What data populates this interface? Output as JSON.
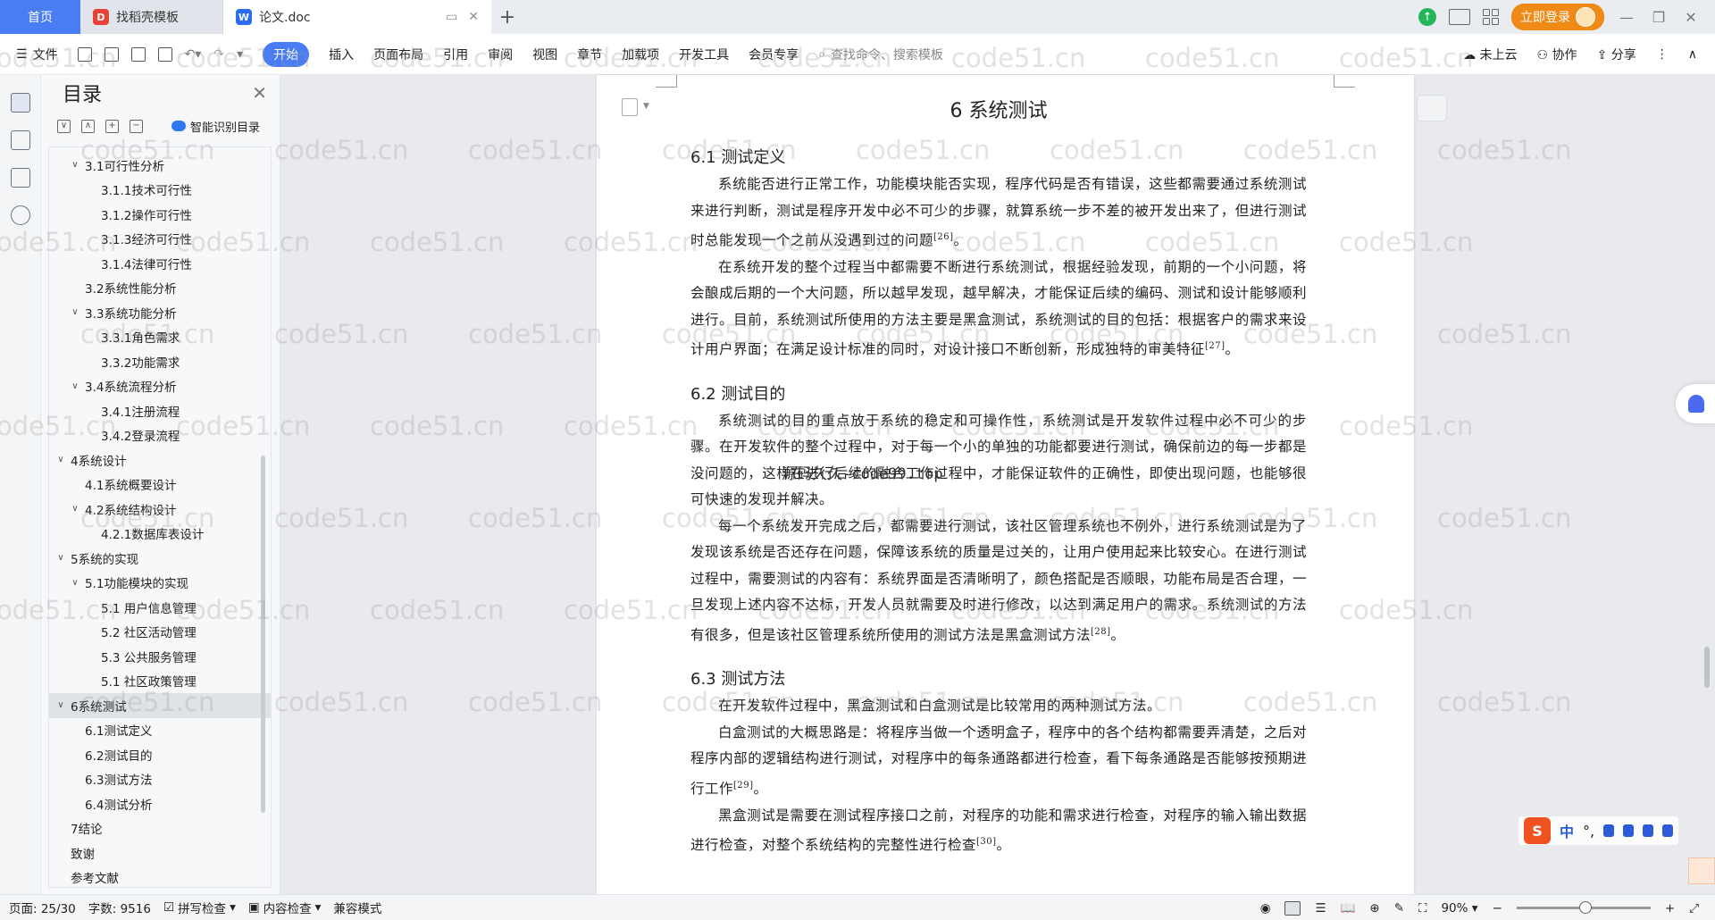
{
  "tabs": {
    "home": "首页",
    "tab1": "找稻壳模板",
    "tab2": "论文.doc",
    "login": "立即登录"
  },
  "ribbon": {
    "file": "文件",
    "items": [
      "开始",
      "插入",
      "页面布局",
      "引用",
      "审阅",
      "视图",
      "章节",
      "加载项",
      "开发工具",
      "会员专享"
    ],
    "search_placeholder": "查找命令、搜索模板",
    "cloud": "未上云",
    "collab": "协作",
    "share": "分享"
  },
  "toc": {
    "title": "目录",
    "smart": "智能识别目录",
    "items": [
      {
        "label": "3.1可行性分析",
        "level": 2,
        "caret": "∨"
      },
      {
        "label": "3.1.1技术可行性",
        "level": 3,
        "caret": ""
      },
      {
        "label": "3.1.2操作可行性",
        "level": 3,
        "caret": ""
      },
      {
        "label": "3.1.3经济可行性",
        "level": 3,
        "caret": ""
      },
      {
        "label": "3.1.4法律可行性",
        "level": 3,
        "caret": ""
      },
      {
        "label": "3.2系统性能分析",
        "level": 2,
        "caret": ""
      },
      {
        "label": "3.3系统功能分析",
        "level": 2,
        "caret": "∨"
      },
      {
        "label": "3.3.1角色需求",
        "level": 3,
        "caret": ""
      },
      {
        "label": "3.3.2功能需求",
        "level": 3,
        "caret": ""
      },
      {
        "label": "3.4系统流程分析",
        "level": 2,
        "caret": "∨"
      },
      {
        "label": "3.4.1注册流程",
        "level": 3,
        "caret": ""
      },
      {
        "label": "3.4.2登录流程",
        "level": 3,
        "caret": ""
      },
      {
        "label": "4系统设计",
        "level": 1,
        "caret": "∨"
      },
      {
        "label": "4.1系统概要设计",
        "level": 2,
        "caret": ""
      },
      {
        "label": "4.2系统结构设计",
        "level": 2,
        "caret": "∨"
      },
      {
        "label": "4.2.1数据库表设计",
        "level": 3,
        "caret": ""
      },
      {
        "label": "5系统的实现",
        "level": 1,
        "caret": "∨"
      },
      {
        "label": "5.1功能模块的实现",
        "level": 2,
        "caret": "∨"
      },
      {
        "label": "5.1 用户信息管理",
        "level": 3,
        "caret": ""
      },
      {
        "label": "5.2 社区活动管理",
        "level": 3,
        "caret": ""
      },
      {
        "label": "5.3 公共服务管理",
        "level": 3,
        "caret": ""
      },
      {
        "label": "5.1 社区政策管理",
        "level": 3,
        "caret": ""
      },
      {
        "label": "6系统测试",
        "level": 1,
        "caret": "∨",
        "selected": true
      },
      {
        "label": "6.1测试定义",
        "level": 2,
        "caret": ""
      },
      {
        "label": "6.2测试目的",
        "level": 2,
        "caret": ""
      },
      {
        "label": "6.3测试方法",
        "level": 2,
        "caret": ""
      },
      {
        "label": "6.4测试分析",
        "level": 2,
        "caret": ""
      },
      {
        "label": "7结论",
        "level": 1,
        "caret": ""
      },
      {
        "label": "致谢",
        "level": 1,
        "caret": ""
      },
      {
        "label": "参考文献",
        "level": 1,
        "caret": ""
      }
    ]
  },
  "doc": {
    "chapter": "6 系统测试",
    "h61": "6.1  测试定义",
    "p1": "系统能否进行正常工作，功能模块能否实现，程序代码是否有错误，这些都需要通过系统测试来进行判断，测试是程序开发中必不可少的步骤，就算系统一步不差的被开发出来了，但进行测试时总能发现一个之前从没遇到过的问题",
    "p1_ref": "[26]",
    "p2": "在系统开发的整个过程当中都需要不断进行系统测试，根据经验发现，前期的一个小问题，将会酿成后期的一个大问题，所以越早发现，越早解决，才能保证后续的编码、测试和设计能够顺利进行。目前，系统测试所使用的方法主要是黑盒测试，系统测试的目的包括：根据客户的需求来设计用户界面；在满足设计标准的同时，对设计接口不断创新，形成独特的审美特征",
    "p2_ref": "[27]",
    "h62": "6.2  测试目的",
    "p3": "系统测试的目的重点放于系统的稳定和可操作性，系统测试是开发软件过程中必不可少的步骤。在开发软件的整个过程中，对于每一个小的单独的功能都要进行测试，确保前边的每一步都是没问题的，这样在进行后续的融合工作过程中，才能保证软件的正确性，即使出现问题，也能够很可快速的发现并解决。",
    "p4": "每一个系统发开完成之后，都需要进行测试，该社区管理系统也不例外，进行系统测试是为了发现该系统是否还存在问题，保障该系统的质量是过关的，让用户使用起来比较安心。在进行测试过程中，需要测试的内容有：系统界面是否清晰明了，颜色搭配是否顺眼，功能布局是否合理，一旦发现上述内容不达标，开发人员就需要及时进行修改，以达到满足用户的需求。系统测试的方法有很多，但是该社区管理系统所使用的测试方法是黑盒测试方法",
    "p4_ref": "[28]",
    "h63": "6.3  测试方法",
    "p5": "在开发软件过程中，黑盒测试和白盒测试是比较常用的两种测试方法。",
    "p6": "白盒测试的大概思路是：将程序当做一个透明盒子，程序中的各个结构都需要弄清楚，之后对程序内部的逻辑结构进行测试，对程序中的每条通路都进行检查，看下每条通路是否能够按预期进行工作",
    "p6_ref": "[29]",
    "p7": "黑盒测试是需要在测试程序接口之前，对程序的功能和需求进行检查，对程序的输入输出数据进行检查，对整个系统结构的完整性进行检查",
    "p7_ref": "[30]"
  },
  "watermark": {
    "text": "code51.cn",
    "center": "源码久久-code99.top"
  },
  "status": {
    "page": "页面: 25/30",
    "words": "字数: 9516",
    "spell": "拼写检查",
    "content": "内容检查",
    "compat": "兼容模式",
    "zoom": "90%"
  },
  "ime": {
    "s": "S",
    "zh": "中",
    "punct": "°,"
  },
  "colors": {
    "accent": "#4a7cf3",
    "login": "#f08a16"
  }
}
